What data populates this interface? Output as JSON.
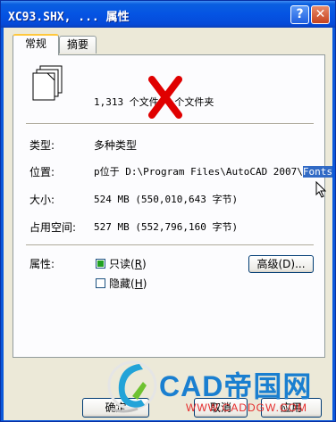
{
  "window": {
    "title": "XC93.SHX, ... 属性"
  },
  "titlebar": {
    "help_glyph": "?",
    "close_glyph": "✕"
  },
  "tabs": [
    {
      "label": "常规"
    },
    {
      "label": "摘要"
    }
  ],
  "summary": {
    "text": "1,313 个文件，  个文件夹"
  },
  "fields": {
    "type_label": "类型:",
    "type_value": "多种类型",
    "location_label": "位置:",
    "location_prefix": "p位于 D:\\Program Files\\AutoCAD 2007\\",
    "location_selected": "Fonts",
    "size_label": "大小:",
    "size_value": "524 MB (550,010,643 字节)",
    "disk_label": "占用空间:",
    "disk_value": "527 MB (552,796,160 字节)"
  },
  "attributes": {
    "label": "属性:",
    "readonly_label": "只读",
    "readonly_key": "R",
    "hidden_label": "隐藏",
    "hidden_key": "H",
    "advanced_label": "高级(D)..."
  },
  "buttons": {
    "ok": "确定",
    "cancel": "取消",
    "apply": "应用"
  },
  "watermark": {
    "brand": "CAD帝国网",
    "url": "WWW.CADDGW.COM"
  },
  "colors": {
    "titlebar": "#0554e3",
    "selection": "#316ac5",
    "mark": "#e00000",
    "brand": "#1a7fd0"
  }
}
